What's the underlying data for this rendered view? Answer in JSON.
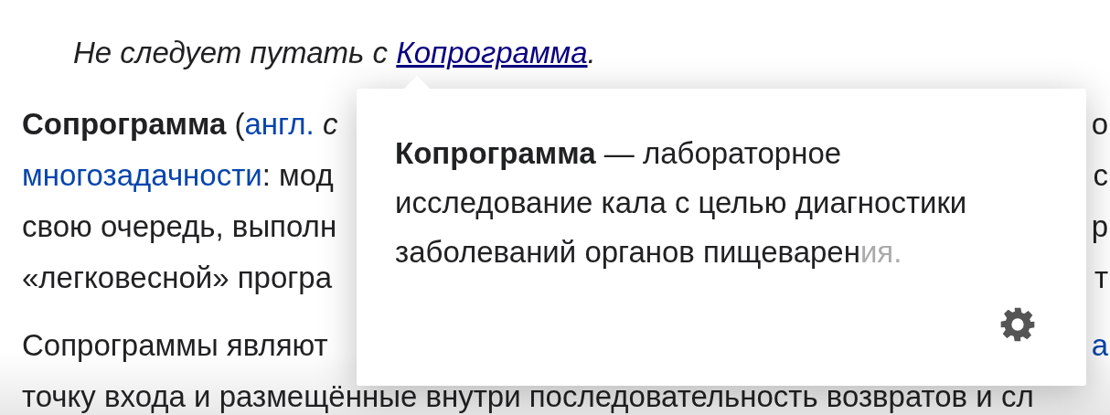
{
  "hatnote": {
    "before": "Не следует путать с ",
    "link": "Копрограмма",
    "after": "."
  },
  "paragraphs": [
    {
      "lines": [
        {
          "left": [
            {
              "t": "Сопрограмма",
              "kind": "bold"
            },
            {
              "t": " (",
              "kind": "plain"
            },
            {
              "t": "англ.",
              "kind": "link"
            },
            {
              "t": " c",
              "kind": "italic"
            }
          ],
          "right": [
            {
              "t": "о",
              "kind": "plain"
            }
          ]
        },
        {
          "left": [
            {
              "t": "многозадачности",
              "kind": "link"
            },
            {
              "t": ": мод",
              "kind": "plain"
            }
          ],
          "right": [
            {
              "t": "с",
              "kind": "plain"
            }
          ]
        },
        {
          "left": [
            {
              "t": "свою очередь, выполн",
              "kind": "plain"
            }
          ],
          "right": [
            {
              "t": "р",
              "kind": "plain"
            }
          ]
        },
        {
          "left": [
            {
              "t": "«легковесной» програ",
              "kind": "plain"
            }
          ],
          "right": [
            {
              "t": "т",
              "kind": "plain"
            }
          ]
        }
      ]
    },
    {
      "lines": [
        {
          "left": [
            {
              "t": "Сопрограммы являют",
              "kind": "plain"
            }
          ],
          "right": [
            {
              "t": "а",
              "kind": "link"
            }
          ]
        },
        {
          "left": [
            {
              "t": "точку входа и размещённые внутри последовательность возвратов и сл",
              "kind": "plain"
            }
          ]
        }
      ]
    }
  ],
  "popup": {
    "text": "**Копрограмма** — лабораторное исследование кала с целью диагностики заболеваний органов пищеварен",
    "faded_end": "ия."
  }
}
